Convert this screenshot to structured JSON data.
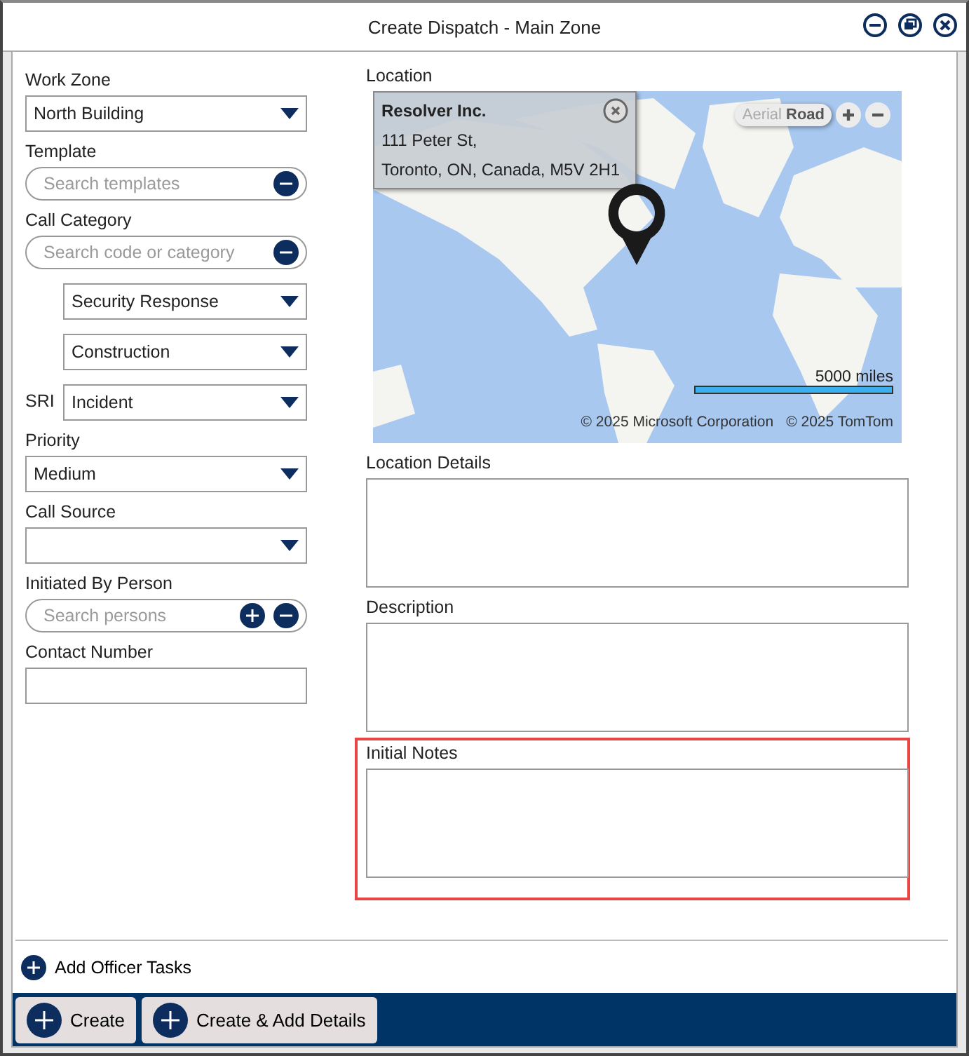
{
  "window": {
    "title": "Create Dispatch - Main Zone"
  },
  "left_fields": [
    {
      "kind": "dropdown",
      "label": "Work Zone",
      "value": "North Building"
    },
    {
      "kind": "search",
      "label": "Template",
      "placeholder": "Search templates"
    },
    {
      "kind": "search",
      "label": "Call Category",
      "placeholder": "Search code or category"
    },
    {
      "kind": "subdropdown",
      "value": "Security Response"
    },
    {
      "kind": "subdropdown",
      "value": "Construction"
    },
    {
      "kind": "subdropdown",
      "prefix": "SRI",
      "value": "Incident"
    },
    {
      "kind": "dropdown",
      "label": "Priority",
      "value": "Medium"
    },
    {
      "kind": "dropdown",
      "label": "Call Source"
    },
    {
      "kind": "person_search",
      "label": "Initiated By Person",
      "placeholder": "Search persons"
    },
    {
      "kind": "text",
      "label": "Contact Number"
    }
  ],
  "location": {
    "label": "Location",
    "popup": {
      "title": "Resolver Inc.",
      "address_lines": [
        "111 Peter St,",
        "Toronto, ON, Canada, M5V 2H1"
      ]
    },
    "map_types": [
      {
        "label": "Aerial",
        "selected": false
      },
      {
        "label": "Road",
        "selected": true
      }
    ],
    "scale": "5000 miles",
    "copyrights": [
      "© 2025 Microsoft Corporation",
      "© 2025 TomTom"
    ]
  },
  "text_areas": [
    {
      "label": "Location Details",
      "highlighted": false
    },
    {
      "label": "Description",
      "highlighted": false
    },
    {
      "label": "Initial Notes",
      "highlighted": true
    }
  ],
  "add_tasks": "Add Officer Tasks",
  "footer_buttons": [
    "Create",
    "Create & Add Details"
  ]
}
